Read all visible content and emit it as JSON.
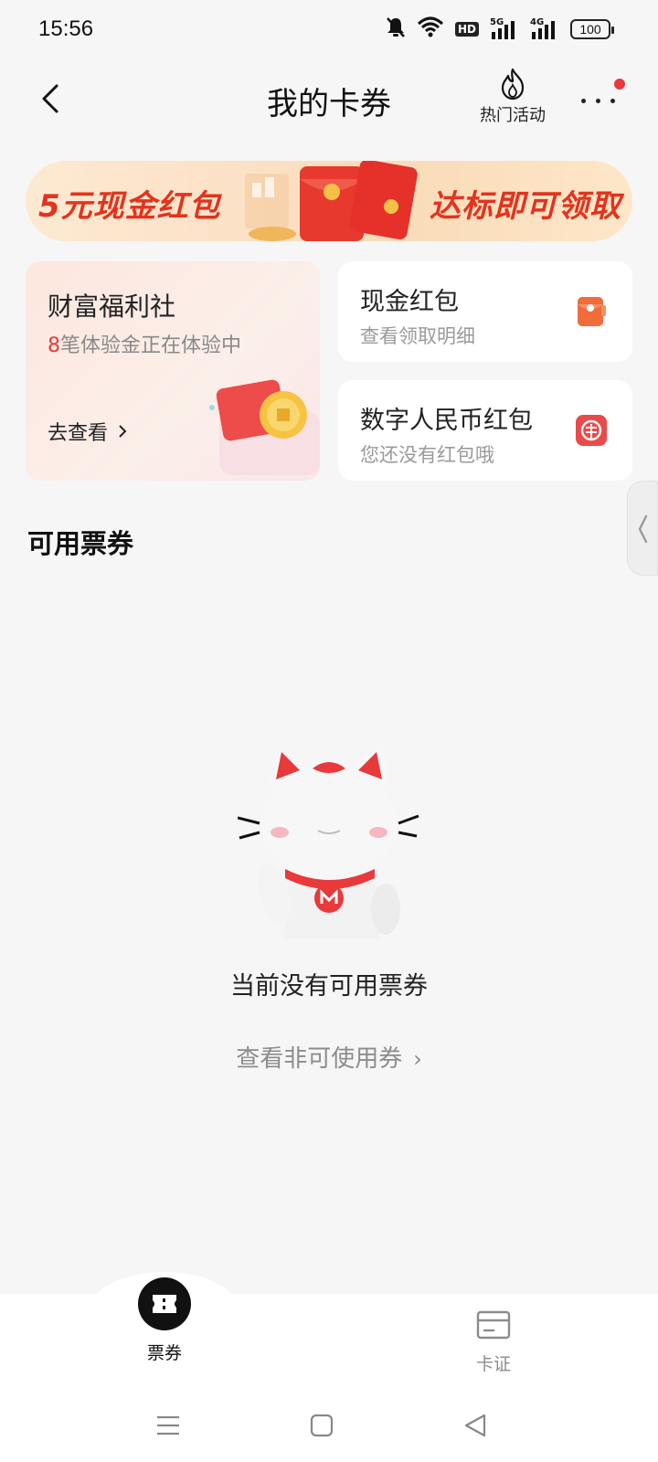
{
  "status_bar": {
    "time": "15:56",
    "network_5g": "5G",
    "network_4g": "4G",
    "hd": "HD",
    "battery": "100",
    "icons": [
      "mute-icon",
      "wifi-icon",
      "hd-icon",
      "signal-5g-icon",
      "signal-4g-icon",
      "battery-icon"
    ]
  },
  "header": {
    "title": "我的卡券",
    "hot_activity": "热门活动",
    "has_notification_dot": true
  },
  "banner": {
    "left_text": "5元现金红包",
    "right_text": "达标即可领取"
  },
  "welfare_card": {
    "title": "财富福利社",
    "sub_count": "8",
    "sub_text": "笔体验金正在体验中",
    "link": "去查看"
  },
  "cash_card": {
    "title": "现金红包",
    "subtitle": "查看领取明细"
  },
  "ecny_card": {
    "title": "数字人民币红包",
    "subtitle": "您还没有红包哦"
  },
  "section": {
    "title": "可用票券"
  },
  "empty_state": {
    "message": "当前没有可用票券",
    "link": "查看非可使用券"
  },
  "bottom_nav": {
    "items": [
      {
        "label": "票券",
        "active": true,
        "icon": "ticket-icon"
      },
      {
        "label": "卡证",
        "active": false,
        "icon": "card-icon"
      }
    ]
  },
  "colors": {
    "accent_red": "#e8393b",
    "banner_text": "#e3331e"
  }
}
